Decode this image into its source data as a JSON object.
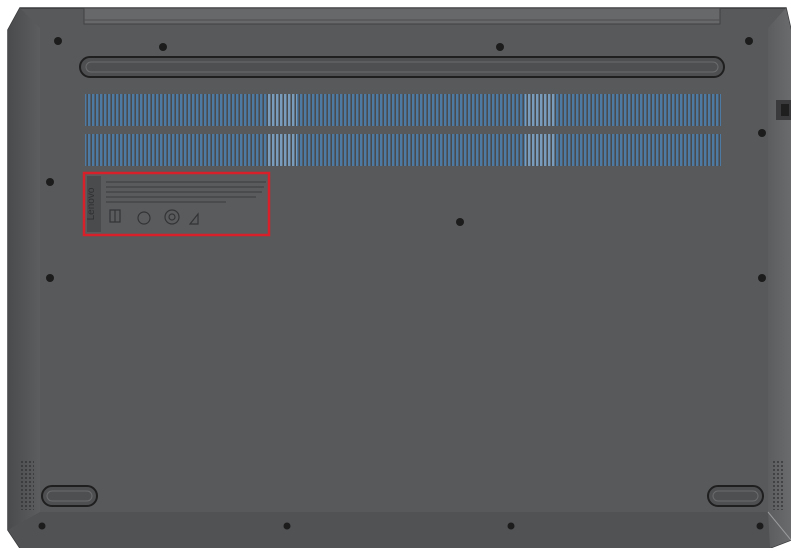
{
  "label": {
    "brand": "Lenovo",
    "highlight_color": "#d8202a"
  },
  "colors": {
    "chassis": "#58595b",
    "chassis_edge": "#3f4042",
    "vent_slot": "#4a7194",
    "vent_center": "#6b8db0",
    "screw": "#1c1c1c"
  },
  "icons": [
    "screw-icon",
    "rubber-foot",
    "speaker-grille",
    "vent",
    "hinge-bar",
    "regulatory-label"
  ]
}
